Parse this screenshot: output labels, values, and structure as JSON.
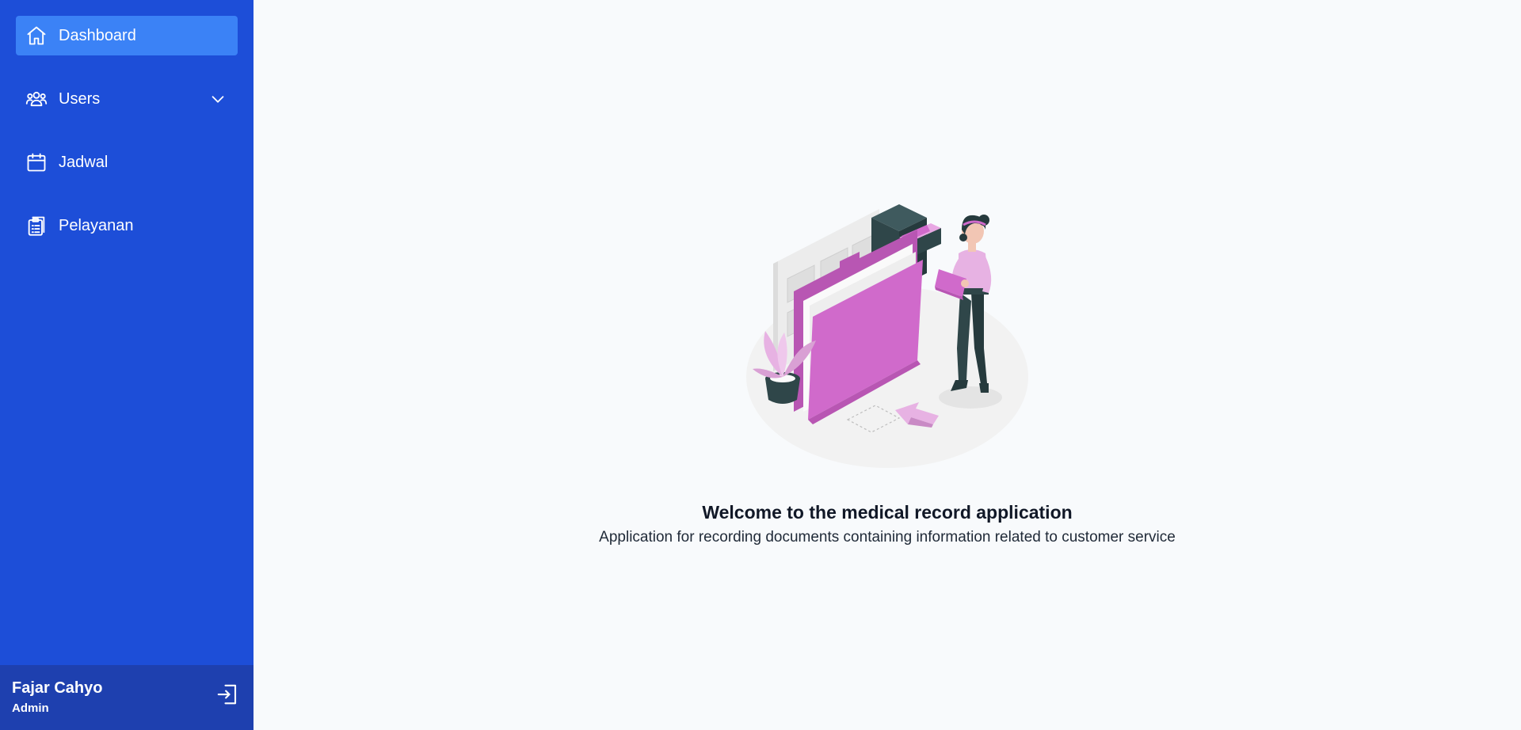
{
  "sidebar": {
    "items": [
      {
        "label": "Dashboard",
        "icon": "home-icon",
        "active": true
      },
      {
        "label": "Users",
        "icon": "users-icon",
        "expandable": true
      },
      {
        "label": "Jadwal",
        "icon": "calendar-icon"
      },
      {
        "label": "Pelayanan",
        "icon": "clipboard-icon"
      }
    ],
    "user": {
      "name": "Fajar Cahyo",
      "role": "Admin"
    }
  },
  "main": {
    "title": "Welcome to the medical record application",
    "subtitle": "Application for recording documents containing information related to customer service"
  },
  "colors": {
    "sidebar_bg": "#1d4ed8",
    "active_item_bg": "#3b82f6",
    "user_panel_bg": "#1e40af",
    "page_bg": "#f8fafc",
    "illustration_accent": "#d06acb"
  }
}
